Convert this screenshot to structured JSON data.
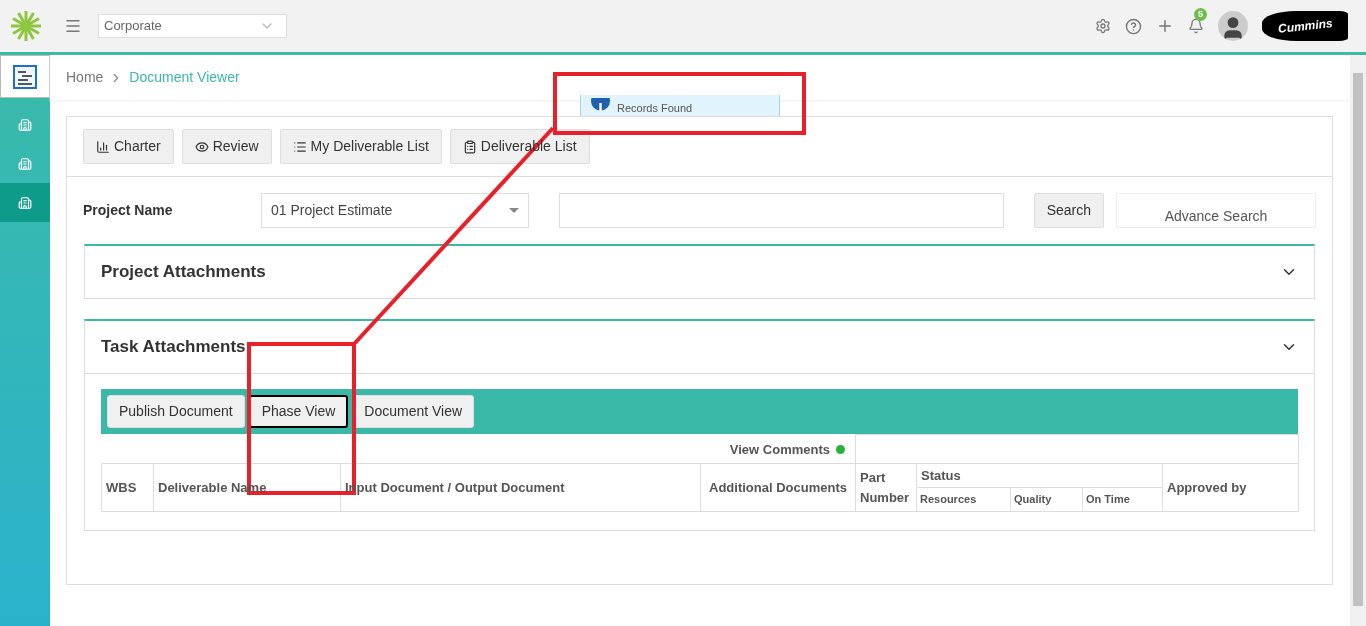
{
  "header": {
    "org_select": "Corporate",
    "notification_count": "5",
    "logo_text": "Cummins"
  },
  "sidebar_items": [
    {
      "selected": false
    },
    {
      "selected": false
    },
    {
      "selected": true
    }
  ],
  "breadcrumb": [
    "Home",
    "Document Viewer"
  ],
  "callout": {
    "text": "Records Found"
  },
  "toolbar": [
    {
      "label": "Charter",
      "kind": "chart"
    },
    {
      "label": "Review",
      "kind": "eye"
    },
    {
      "label": "My Deliverable List",
      "kind": "list"
    },
    {
      "label": "Deliverable List",
      "kind": "clipboard"
    }
  ],
  "filter": {
    "label": "Project Name",
    "project": "01 Project Estimate",
    "search_button": "Search",
    "advance_search": "Advance Search"
  },
  "sections": [
    {
      "title": "Project Attachments",
      "expanded": false
    },
    {
      "title": "Task Attachments",
      "expanded": true
    }
  ],
  "task_buttons": [
    {
      "label": "Publish Document",
      "selected": false
    },
    {
      "label": "Phase View",
      "selected": true
    },
    {
      "label": "Document View",
      "selected": false
    }
  ],
  "view_comments": {
    "label": "View Comments",
    "color": "#2ab13a"
  },
  "table": {
    "columns": [
      "WBS",
      "Deliverable Name",
      "Input Document / Output Document",
      "Additional Documents",
      "Part Number"
    ],
    "status": {
      "title": "Status",
      "children": [
        "Resources",
        "Quality",
        "On Time"
      ]
    },
    "last_column": "Approved by"
  }
}
